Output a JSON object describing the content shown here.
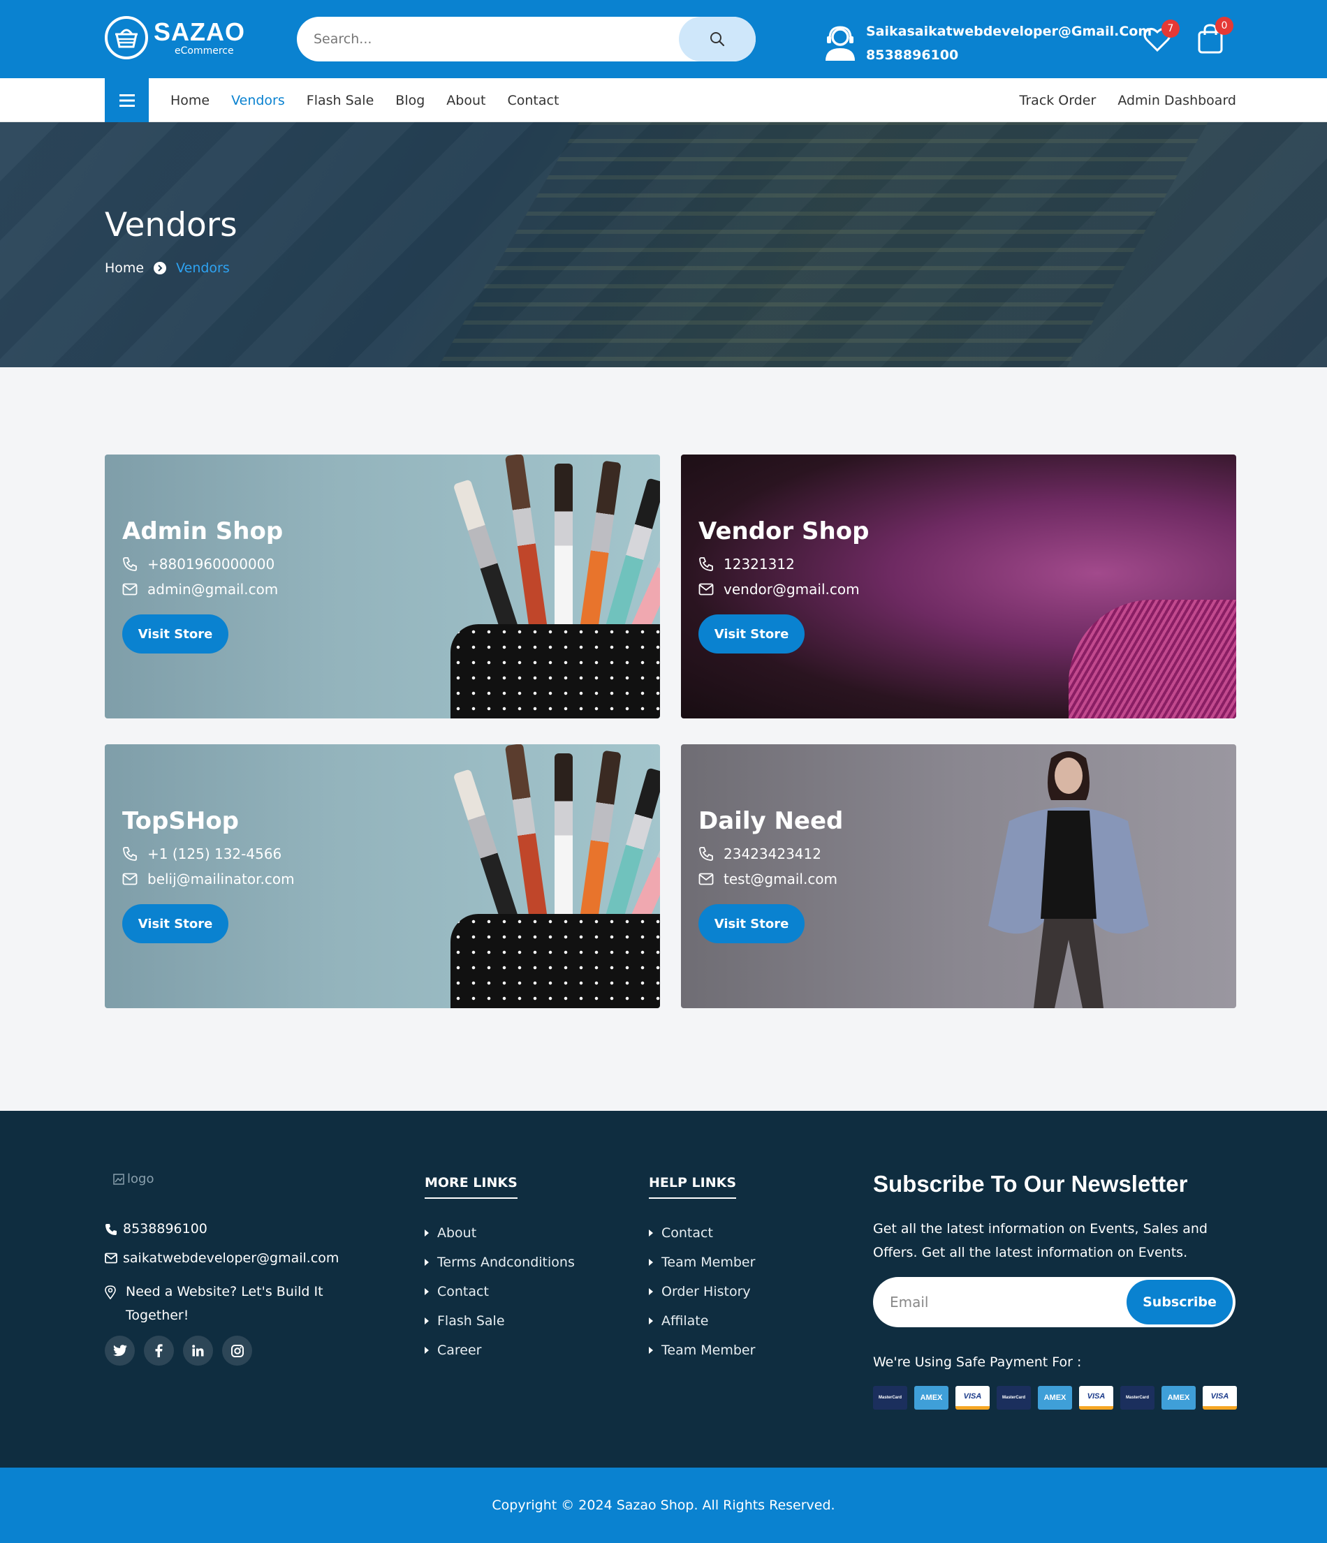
{
  "header": {
    "logo_title": "SAZAO",
    "logo_sub": "eCommerce",
    "search_placeholder": "Search...",
    "contact_email": "Saikasaikatwebdeveloper@Gmail.Com",
    "contact_phone": "8538896100",
    "wishlist_count": "7",
    "cart_count": "0",
    "brand_color": "#0a82d0"
  },
  "nav": {
    "links": [
      "Home",
      "Vendors",
      "Flash Sale",
      "Blog",
      "About",
      "Contact"
    ],
    "active": "Vendors",
    "right_links": [
      "Track Order",
      "Admin Dashboard"
    ]
  },
  "hero": {
    "title": "Vendors",
    "breadcrumb_home": "Home",
    "breadcrumb_current": "Vendors"
  },
  "vendors": [
    {
      "name": "Admin Shop",
      "phone": "+8801960000000",
      "email": "admin@gmail.com",
      "button": "Visit Store"
    },
    {
      "name": "Vendor Shop",
      "phone": "12321312",
      "email": "vendor@gmail.com",
      "button": "Visit Store"
    },
    {
      "name": "TopSHop",
      "phone": "+1 (125) 132-4566",
      "email": "belij@mailinator.com",
      "button": "Visit Store"
    },
    {
      "name": "Daily Need",
      "phone": "23423423412",
      "email": "test@gmail.com",
      "button": "Visit Store"
    }
  ],
  "footer": {
    "logo_alt": "logo",
    "phone": "8538896100",
    "email": "saikatwebdeveloper@gmail.com",
    "address": "Need a Website? Let's Build It Together!",
    "socials": [
      "twitter-icon",
      "facebook-icon",
      "linkedin-icon",
      "instagram-icon"
    ],
    "more_links_title": "MORE LINKS",
    "more_links": [
      "About",
      "Terms Andconditions",
      "Contact",
      "Flash Sale",
      "Career"
    ],
    "help_links_title": "HELP LINKS",
    "help_links": [
      "Contact",
      "Team Member",
      "Order History",
      "Affilate",
      "Team Member"
    ],
    "newsletter_title": "Subscribe To Our Newsletter",
    "newsletter_text": "Get all the latest information on Events, Sales and Offers. Get all the latest information on Events.",
    "newsletter_placeholder": "Email",
    "newsletter_button": "Subscribe",
    "payment_label": "We're Using Safe Payment For :",
    "payment_cards": [
      {
        "type": "mc",
        "label": "MasterCard"
      },
      {
        "type": "amex",
        "label": "AMEX"
      },
      {
        "type": "visa",
        "label": "VISA"
      },
      {
        "type": "mc",
        "label": "MasterCard"
      },
      {
        "type": "amex",
        "label": "AMEX"
      },
      {
        "type": "visa",
        "label": "VISA"
      },
      {
        "type": "mc",
        "label": "MasterCard"
      },
      {
        "type": "amex",
        "label": "AMEX"
      },
      {
        "type": "visa",
        "label": "VISA"
      }
    ],
    "copyright": "Copyright © 2024 Sazao Shop. All Rights Reserved."
  }
}
